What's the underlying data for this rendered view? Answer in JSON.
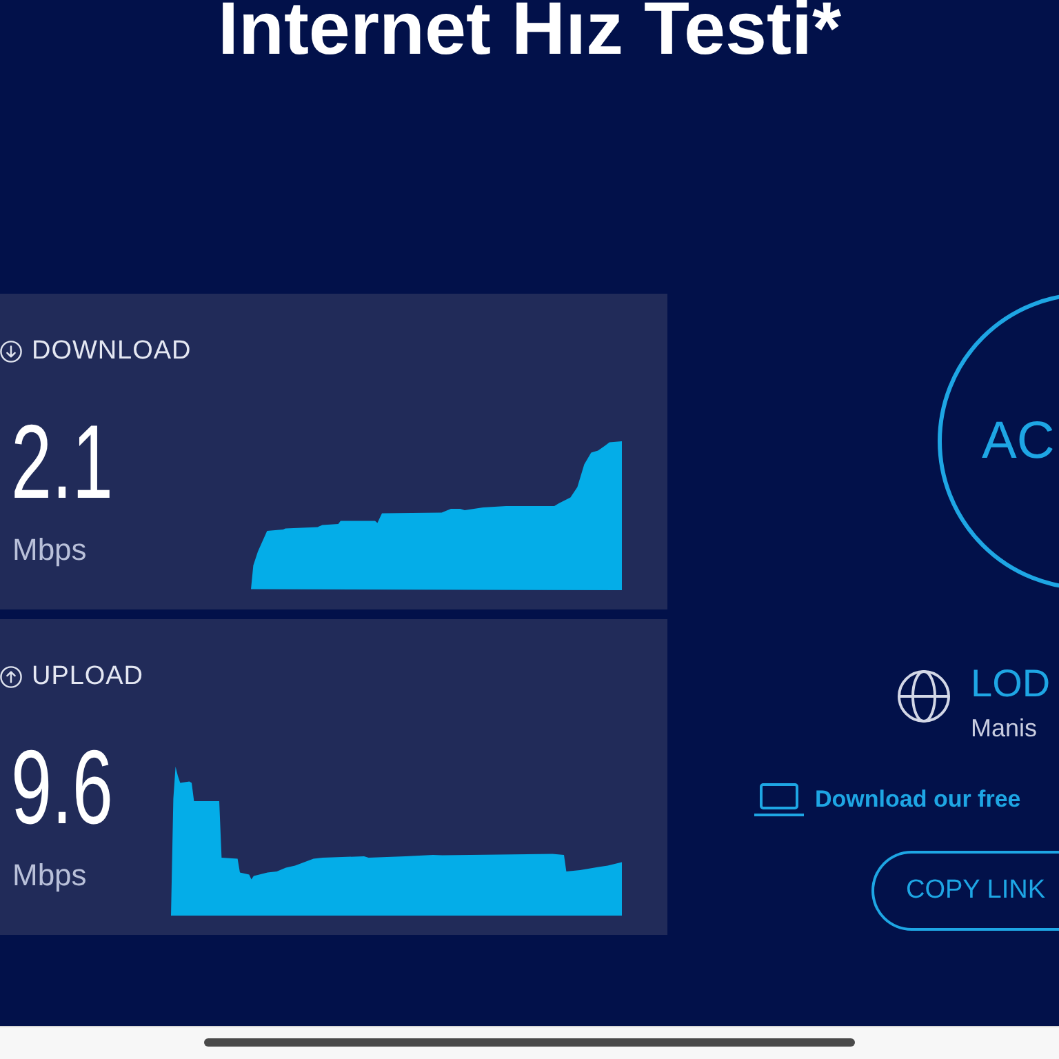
{
  "title": "Internet Hız Testi*",
  "results": [
    {
      "kind": "download",
      "label": "DOWNLOAD",
      "value": "2.1",
      "unit": "Mbps"
    },
    {
      "kind": "upload",
      "label": "UPLOAD",
      "value": "9.6",
      "unit": "Mbps"
    }
  ],
  "go_button": {
    "label": "AC"
  },
  "server": {
    "name": "LOD",
    "location": "Manis"
  },
  "app_link": {
    "label": "Download our free"
  },
  "copy_link_button": {
    "label": "COPY LINK"
  }
}
